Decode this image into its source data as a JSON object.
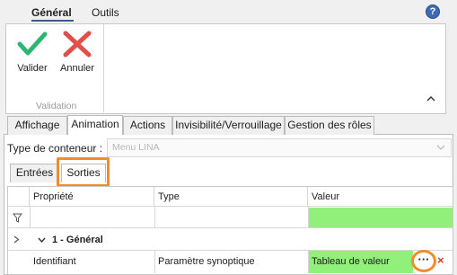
{
  "ribbon": {
    "tabs": [
      {
        "label": "Général",
        "active": true
      },
      {
        "label": "Outils",
        "active": false
      }
    ],
    "help_icon": "?",
    "buttons": [
      {
        "label": "Valider",
        "icon": "check-icon",
        "color": "#2bb673"
      },
      {
        "label": "Annuler",
        "icon": "cross-icon",
        "color": "#e0504a"
      }
    ],
    "group_label": "Validation"
  },
  "main_tabs": [
    {
      "label": "Affichage",
      "active": false
    },
    {
      "label": "Animation",
      "active": true
    },
    {
      "label": "Actions",
      "active": false
    },
    {
      "label": "Invisibilité/Verrouillage",
      "active": false
    },
    {
      "label": "Gestion des rôles",
      "active": false
    }
  ],
  "container": {
    "label": "Type de conteneur :",
    "value": "Menu LINA"
  },
  "sub_tabs": [
    {
      "label": "Entrées",
      "active": false
    },
    {
      "label": "Sorties",
      "active": true
    }
  ],
  "grid": {
    "columns": [
      "Propriété",
      "Type",
      "Valeur"
    ],
    "group": {
      "label": "1 - Général"
    },
    "rows": [
      {
        "property": "Identifiant",
        "type": "Paramètre synoptique",
        "value": "Tableau de valeur"
      }
    ],
    "ellipsis": "···",
    "delete": "×"
  },
  "colors": {
    "accent_tab": "#3c5a8c",
    "highlight": "#f08c2a",
    "value_green": "#90f07a"
  }
}
